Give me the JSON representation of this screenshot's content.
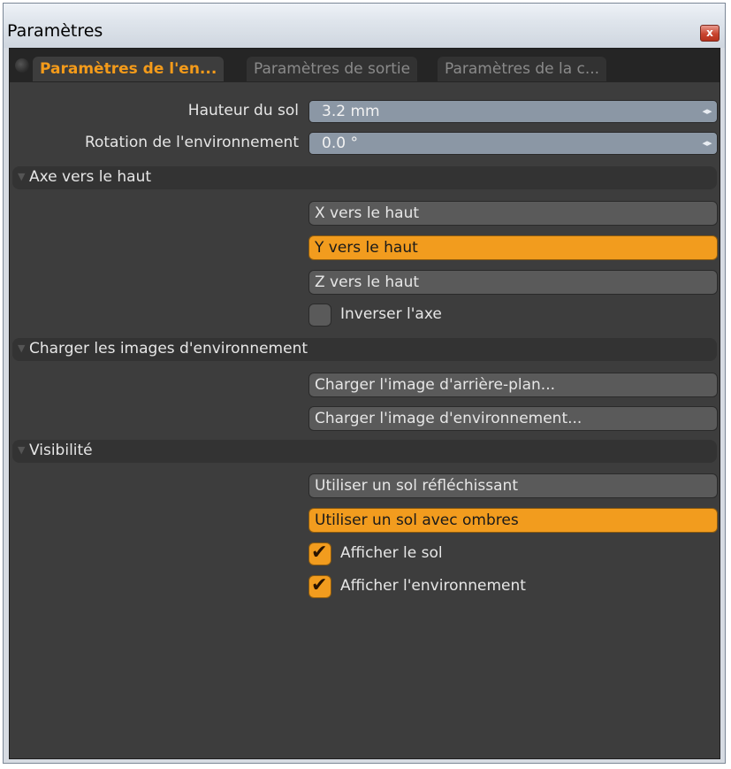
{
  "window": {
    "title": "Paramètres",
    "close_glyph": "x"
  },
  "tabs": [
    {
      "label": "Paramètres de l'en...",
      "active": true
    },
    {
      "label": "Paramètres de sortie",
      "active": false
    },
    {
      "label": "Paramètres de la c...",
      "active": false
    }
  ],
  "fields": {
    "ground_height": {
      "label": "Hauteur du sol",
      "value": "3.2 mm"
    },
    "env_rotation": {
      "label": "Rotation de l'environnement",
      "value": "0.0 °"
    }
  },
  "sections": {
    "up_axis": {
      "label": "Axe vers le haut",
      "buttons": [
        {
          "label": "X vers le haut",
          "selected": false
        },
        {
          "label": "Y vers le haut",
          "selected": true
        },
        {
          "label": "Z vers le haut",
          "selected": false
        }
      ],
      "invert": {
        "label": "Inverser l'axe",
        "checked": false
      }
    },
    "load_images": {
      "label": "Charger les images d'environnement",
      "buttons": [
        {
          "label": "Charger l'image d'arrière-plan..."
        },
        {
          "label": "Charger l'image d'environnement..."
        }
      ]
    },
    "visibility": {
      "label": "Visibilité",
      "buttons": [
        {
          "label": "Utiliser un sol réfléchissant",
          "selected": false
        },
        {
          "label": "Utiliser un sol avec ombres",
          "selected": true
        }
      ],
      "checks": [
        {
          "label": "Afficher le sol",
          "checked": true
        },
        {
          "label": "Afficher l'environnement",
          "checked": true
        }
      ]
    }
  },
  "colors": {
    "accent": "#f29c1e",
    "panel": "#3d3d3d",
    "field": "#8b97a5"
  },
  "icons": {
    "check": "✔",
    "spin": "◂▸",
    "triangle": "▼"
  }
}
